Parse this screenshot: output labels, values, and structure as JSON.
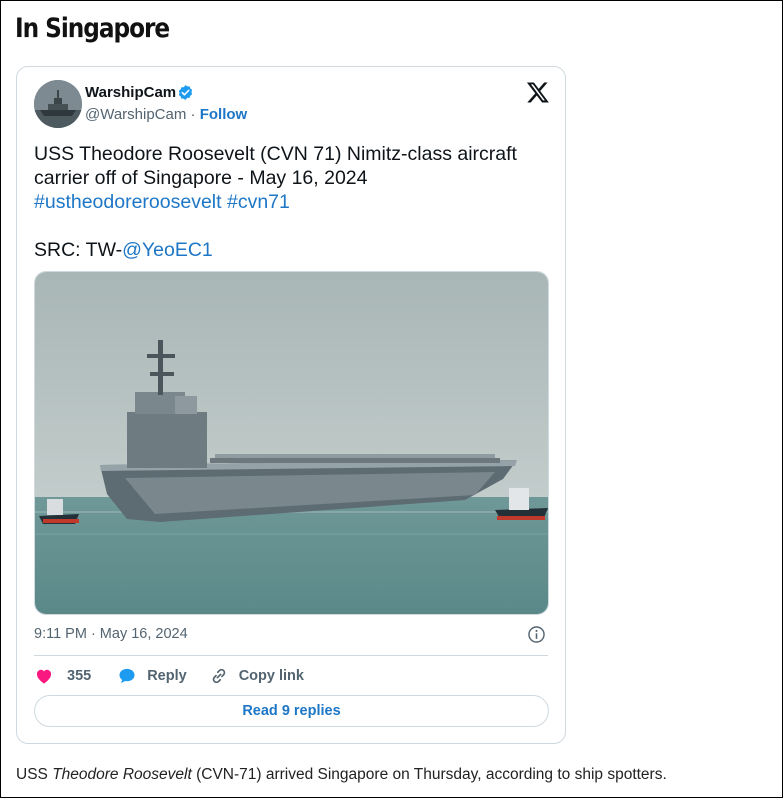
{
  "article": {
    "section_heading": "In Singapore",
    "caption": {
      "prefix": "USS ",
      "ship_name": "Theodore Roosevelt",
      "suffix": " (CVN-71) arrived Singapore on Thursday, according to ship spotters."
    }
  },
  "tweet": {
    "author": {
      "name": "WarshipCam",
      "handle": "@WarshipCam",
      "separator": " · ",
      "follow_label": "Follow",
      "verified": true,
      "avatar_icon": "warship-avatar"
    },
    "platform_icon": "x-logo-icon",
    "text": {
      "line1": "USS Theodore Roosevelt (CVN 71) Nimitz-class aircraft carrier off of Singapore - May 16, 2024",
      "hashtag1": "#ustheodoreroosevelt",
      "hashtag2": "#cvn71",
      "src_prefix": "SRC: TW-",
      "src_mention": "@YeoEC1"
    },
    "media": {
      "description_icon": "aircraft-carrier-photo"
    },
    "timestamp": "9:11 PM · May 16, 2024",
    "info_icon": "info-icon",
    "actions": {
      "like_count": "355",
      "reply_label": "Reply",
      "copy_label": "Copy link"
    },
    "read_replies_label": "Read 9 replies"
  },
  "colors": {
    "link": "#1d77c6",
    "like": "#f91880",
    "reply_bubble": "#1d9bf0",
    "muted": "#536471",
    "border": "#cfd9de"
  }
}
